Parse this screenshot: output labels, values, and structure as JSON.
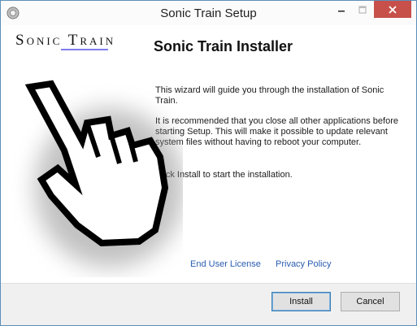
{
  "window": {
    "title": "Sonic Train Setup",
    "app_icon": "installer-icon",
    "controls": {
      "minimize_icon": "minimize-icon",
      "maximize_icon": "maximize-icon",
      "close_icon": "close-icon"
    }
  },
  "header": {
    "logo_text": "Sonic Train",
    "title": "Sonic Train Installer"
  },
  "body": {
    "paragraph1": "This wizard will guide you through the installation of Sonic Train.",
    "paragraph2": "It is recommended that you close all other applications before starting Setup. This will make it possible to update relevant system files without having to reboot your computer.",
    "paragraph3": "Click Install to start the installation."
  },
  "links": {
    "eula": "End User License",
    "privacy": "Privacy Policy"
  },
  "buttons": {
    "install": "Install",
    "cancel": "Cancel"
  },
  "colors": {
    "close_button": "#c7504b",
    "link": "#2a5db0",
    "logo_underline": "#7d7df0"
  }
}
